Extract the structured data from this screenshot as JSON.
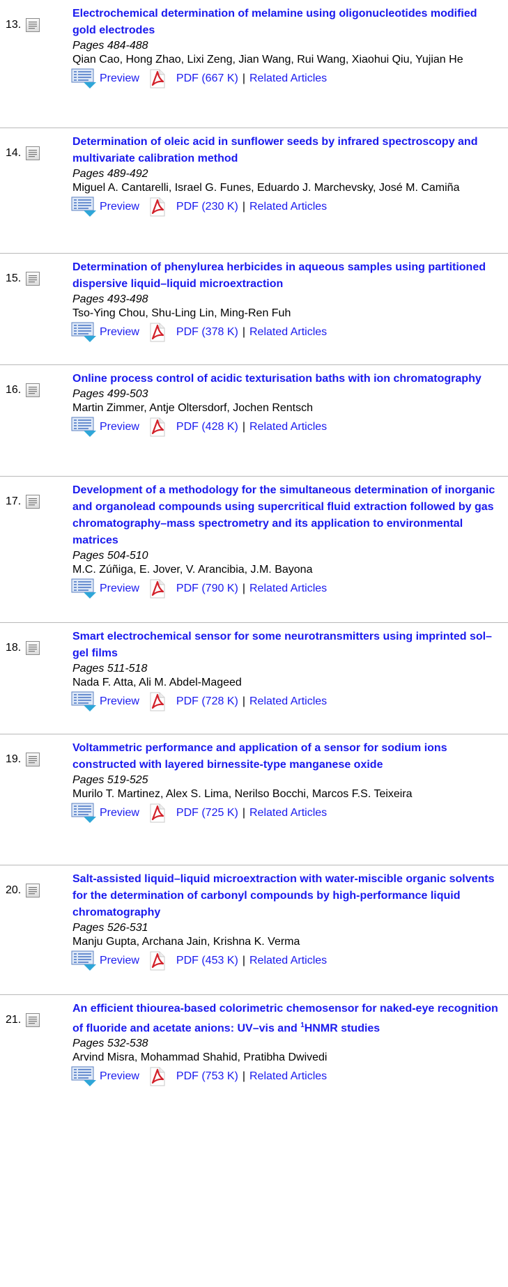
{
  "articles": [
    {
      "number": "13.",
      "title": "Electrochemical determination of melamine using oligonucleotides modified gold electrodes",
      "pages": "Pages 484-488",
      "authors": "Qian Cao, Hong Zhao, Lixi Zeng, Jian Wang, Rui Wang, Xiaohui Qiu, Yujian He",
      "preview": "Preview",
      "pdf": "PDF (667 K)",
      "separator": "|",
      "related": "Related Articles"
    },
    {
      "number": "14.",
      "title": "Determination of oleic acid in sunflower seeds by infrared spectroscopy and multivariate calibration method",
      "pages": "Pages 489-492",
      "authors": "Miguel A. Cantarelli, Israel G. Funes, Eduardo J. Marchevsky, José M. Camiña",
      "preview": "Preview",
      "pdf": "PDF (230 K)",
      "separator": "|",
      "related": "Related Articles"
    },
    {
      "number": "15.",
      "title": "Determination of phenylurea herbicides in aqueous samples using partitioned dispersive liquid–liquid microextraction",
      "pages": "Pages 493-498",
      "authors": "Tso-Ying Chou, Shu-Ling Lin, Ming-Ren Fuh",
      "preview": "Preview",
      "pdf": "PDF (378 K)",
      "separator": "|",
      "related": "Related Articles"
    },
    {
      "number": "16.",
      "title": "Online process control of acidic texturisation baths with ion chromatography",
      "pages": "Pages 499-503",
      "authors": "Martin Zimmer, Antje Oltersdorf, Jochen Rentsch",
      "preview": "Preview",
      "pdf": "PDF (428 K)",
      "separator": "|",
      "related": "Related Articles"
    },
    {
      "number": "17.",
      "title": "Development of a methodology for the simultaneous determination of inorganic and organolead compounds using supercritical fluid extraction followed by gas chromatography–mass spectrometry and its application to environmental matrices",
      "pages": "Pages 504-510",
      "authors": "M.C. Zúñiga, E. Jover, V. Arancibia, J.M. Bayona",
      "preview": "Preview",
      "pdf": "PDF (790 K)",
      "separator": "|",
      "related": "Related Articles"
    },
    {
      "number": "18.",
      "title": "Smart electrochemical sensor for some neurotransmitters using imprinted sol–gel films",
      "pages": "Pages 511-518",
      "authors": "Nada F. Atta, Ali M. Abdel-Mageed",
      "preview": "Preview",
      "pdf": "PDF (728 K)",
      "separator": "|",
      "related": "Related Articles"
    },
    {
      "number": "19.",
      "title": "Voltammetric performance and application of a sensor for sodium ions constructed with layered birnessite-type manganese oxide",
      "pages": "Pages 519-525",
      "authors": "Murilo T. Martinez, Alex S. Lima, Nerilso Bocchi, Marcos F.S. Teixeira",
      "preview": "Preview",
      "pdf": "PDF (725 K)",
      "separator": "|",
      "related": "Related Articles"
    },
    {
      "number": "20.",
      "title": "Salt-assisted liquid–liquid microextraction with water-miscible organic solvents for the determination of carbonyl compounds by high-performance liquid chromatography",
      "pages": "Pages 526-531",
      "authors": "Manju Gupta, Archana Jain, Krishna K. Verma",
      "preview": "Preview",
      "pdf": "PDF (453 K)",
      "separator": "|",
      "related": "Related Articles"
    },
    {
      "number": "21.",
      "title_part1": "An efficient thiourea-based colorimetric chemosensor for naked-eye recognition of fluoride and acetate anions: UV–vis and ",
      "title_sup": "1",
      "title_part2": "HNMR studies",
      "pages": "Pages 532-538",
      "authors": "Arvind Misra, Mohammad Shahid, Pratibha Dwivedi",
      "preview": "Preview",
      "pdf": "PDF (753 K)",
      "separator": "|",
      "related": "Related Articles"
    }
  ],
  "colors": {
    "link": "#1a1aee",
    "divider": "#b9b9b9"
  },
  "icons": {
    "doc": "document-icon",
    "preview": "preview-icon",
    "pdf": "pdf-icon"
  }
}
